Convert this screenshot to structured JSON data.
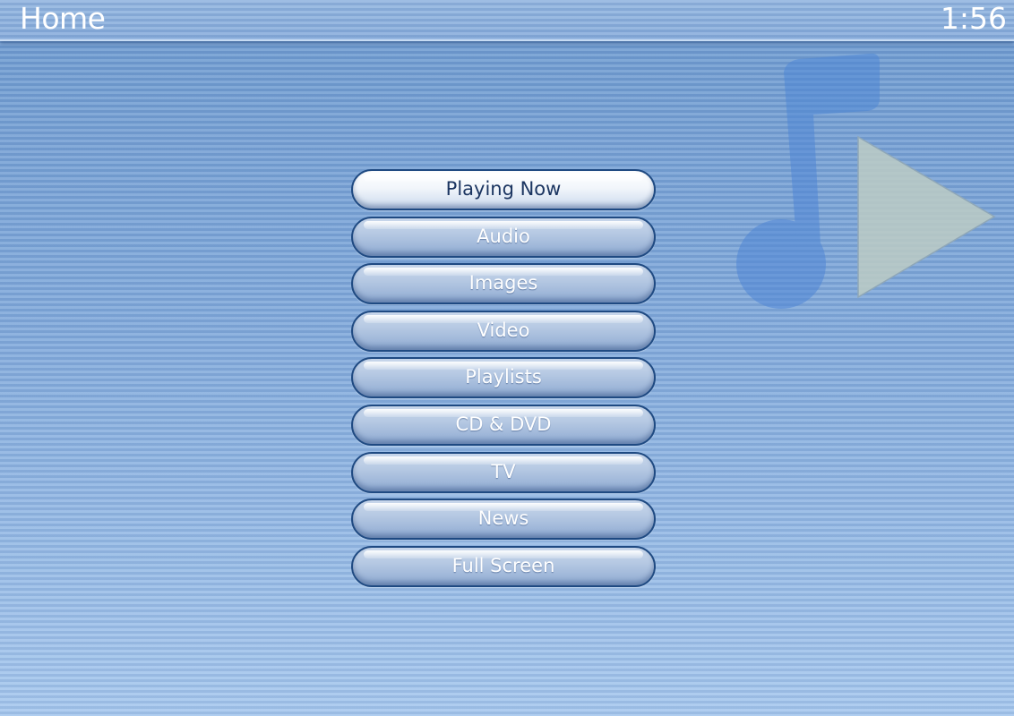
{
  "header": {
    "title": "Home",
    "clock": "1:56"
  },
  "decoration": {
    "icon": "music-note-play-icon",
    "note_color": "#5a8fd8",
    "play_color": "#b9c9c2"
  },
  "menu": {
    "selected_index": 0,
    "items": [
      {
        "label": "Playing Now"
      },
      {
        "label": "Audio"
      },
      {
        "label": "Images"
      },
      {
        "label": "Video"
      },
      {
        "label": "Playlists"
      },
      {
        "label": "CD & DVD"
      },
      {
        "label": "TV"
      },
      {
        "label": "News"
      },
      {
        "label": "Full Screen"
      }
    ]
  }
}
